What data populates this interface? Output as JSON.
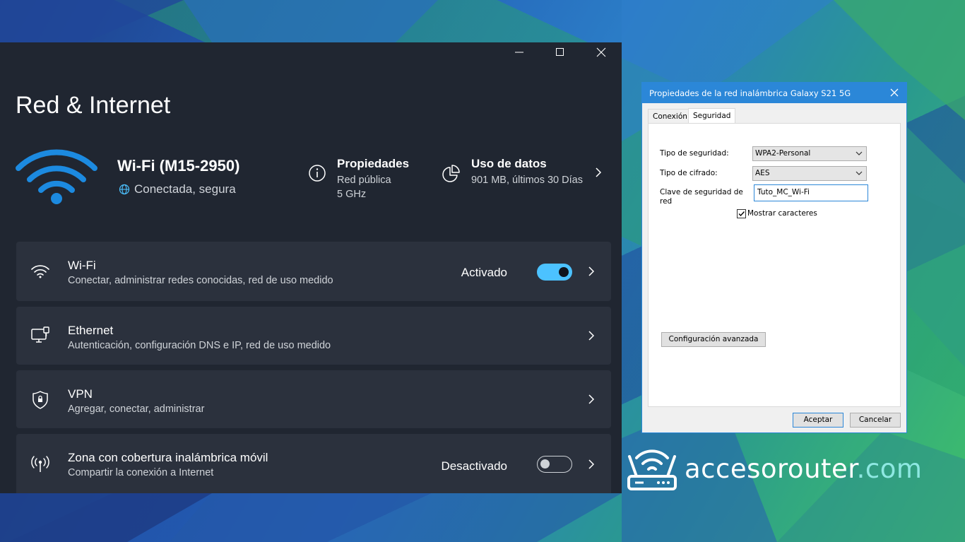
{
  "settings": {
    "page_title": "Red & Internet",
    "network": {
      "name": "Wi-Fi (M15-2950)",
      "status": "Conectada, segura"
    },
    "properties": {
      "title": "Propiedades",
      "line1": "Red pública",
      "line2": "5 GHz"
    },
    "data_usage": {
      "title": "Uso de datos",
      "line1": "901 MB, últimos 30 Días"
    },
    "cards": [
      {
        "title": "Wi-Fi",
        "subtitle": "Conectar, administrar redes conocidas, red de uso medido",
        "state": "Activado",
        "toggle_on": true
      },
      {
        "title": "Ethernet",
        "subtitle": "Autenticación, configuración DNS e IP, red de uso medido"
      },
      {
        "title": "VPN",
        "subtitle": "Agregar, conectar, administrar"
      },
      {
        "title": "Zona con cobertura inalámbrica móvil",
        "subtitle": "Compartir la conexión a Internet",
        "state": "Desactivado",
        "toggle_on": false
      }
    ],
    "accent_color": "#4cc2ff"
  },
  "dialog": {
    "title": "Propiedades de la red inalámbrica Galaxy S21 5G",
    "tabs": [
      "Conexión",
      "Seguridad"
    ],
    "active_tab": "Seguridad",
    "security_type_label": "Tipo de seguridad:",
    "security_type_value": "WPA2-Personal",
    "encryption_label": "Tipo de cifrado:",
    "encryption_value": "AES",
    "key_label_line1": "Clave de seguridad de",
    "key_label_line2": "red",
    "key_value": "Tuto_MC_Wi-Fi",
    "show_chars_label": "Mostrar caracteres",
    "show_chars_checked": true,
    "advanced_button": "Configuración avanzada",
    "accept_button": "Aceptar",
    "cancel_button": "Cancelar",
    "accent_color": "#2b87d8"
  },
  "watermark": {
    "brand": "accesorouter",
    "domain": ".com"
  }
}
